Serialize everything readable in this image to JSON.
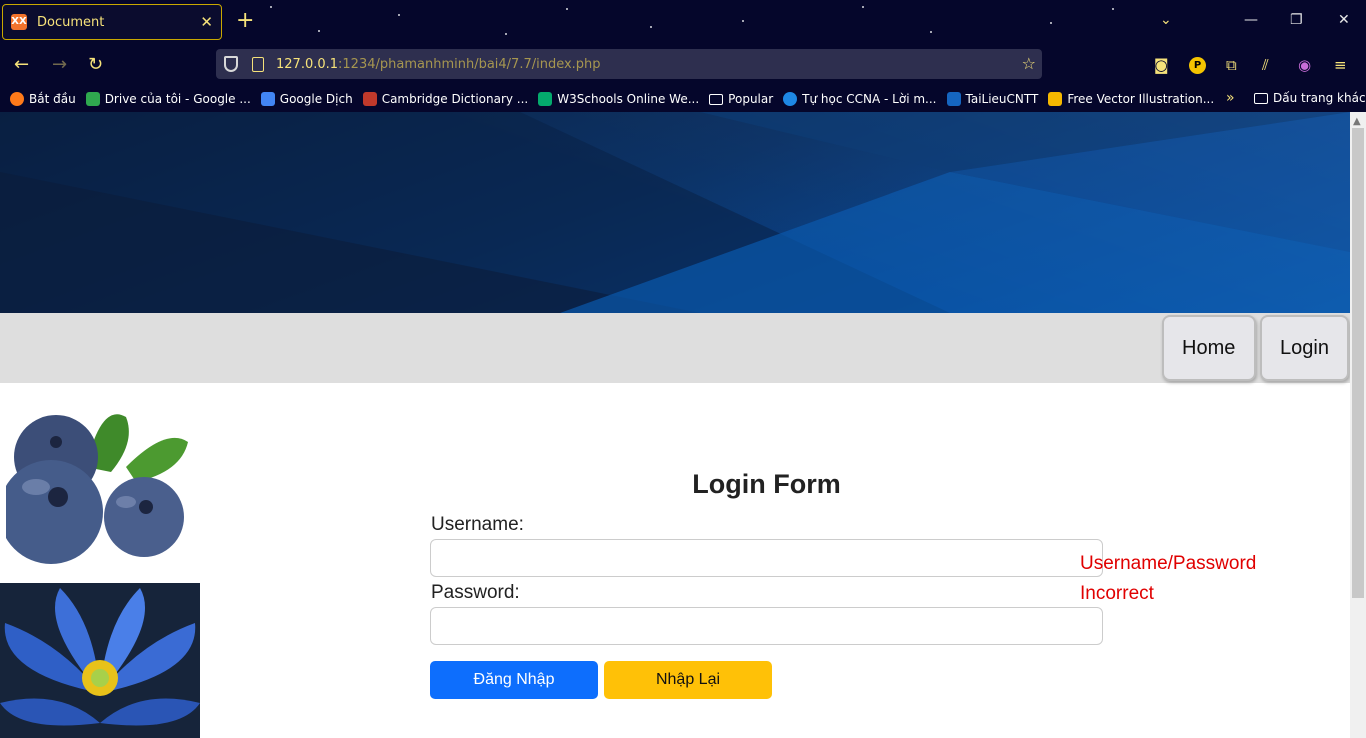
{
  "browser": {
    "tab_title": "Document",
    "tab_favicon_text": "XX",
    "url_host": "127.0.0.1",
    "url_rest": ":1234/phamanhminh/bai4/7.7/index.php",
    "profile_badge": "P",
    "bookmarks": [
      {
        "label": "Bắt đầu",
        "color": "#ff7a1a"
      },
      {
        "label": "Drive của tôi - Google ...",
        "color": "#2fa84f"
      },
      {
        "label": "Google Dịch",
        "color": "#4285f4"
      },
      {
        "label": "Cambridge Dictionary ...",
        "color": "#c0392b"
      },
      {
        "label": "W3Schools Online We...",
        "color": "#04aa6d"
      },
      {
        "label": "Popular",
        "folder": true
      },
      {
        "label": "Tự học CCNA - Lời m...",
        "color": "#1e88e5"
      },
      {
        "label": "TaiLieuCNTT",
        "color": "#1565c0"
      },
      {
        "label": "Free Vector Illustration...",
        "color": "#f5b800"
      }
    ],
    "other_bookmarks": "Dấu trang khác"
  },
  "page": {
    "menu": {
      "home": "Home",
      "login": "Login"
    },
    "form": {
      "title": "Login Form",
      "username_label": "Username:",
      "username_value": "",
      "password_label": "Password:",
      "password_value": "",
      "submit_label": "Đăng Nhập",
      "reset_label": "Nhập Lại"
    },
    "error": {
      "line1": "Username/Password",
      "line2": "Incorrect"
    }
  },
  "colors": {
    "chrome_bg": "#05062b",
    "chrome_accent": "#f6e27a",
    "submit_button": "#0d6efd",
    "reset_button": "#ffc107",
    "error_text": "#e00000"
  }
}
